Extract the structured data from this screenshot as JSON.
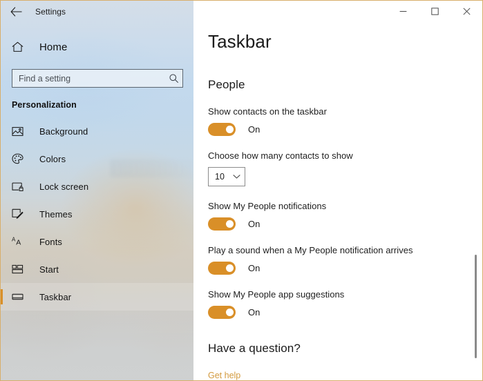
{
  "window": {
    "border_color": "#d8ae6a",
    "accent_color": "#d98f28",
    "link_color": "#d39a3e"
  },
  "titlebar": {
    "back_label": "back-arrow",
    "app_title": "Settings",
    "minimize_label": "Minimize",
    "maximize_label": "Maximize",
    "close_label": "Close"
  },
  "sidebar": {
    "home_label": "Home",
    "search": {
      "placeholder": "Find a setting",
      "value": ""
    },
    "group_label": "Personalization",
    "items": [
      {
        "label": "Background",
        "icon": "picture-icon",
        "selected": false
      },
      {
        "label": "Colors",
        "icon": "palette-icon",
        "selected": false
      },
      {
        "label": "Lock screen",
        "icon": "lock-screen-icon",
        "selected": false
      },
      {
        "label": "Themes",
        "icon": "themes-icon",
        "selected": false
      },
      {
        "label": "Fonts",
        "icon": "fonts-icon",
        "selected": false
      },
      {
        "label": "Start",
        "icon": "start-icon",
        "selected": false
      },
      {
        "label": "Taskbar",
        "icon": "taskbar-icon",
        "selected": true
      }
    ]
  },
  "main": {
    "page_title": "Taskbar",
    "sections": [
      {
        "title": "People",
        "settings": [
          {
            "label": "Show contacts on the taskbar",
            "control": "toggle",
            "state": "On"
          },
          {
            "label": "Choose how many contacts to show",
            "control": "dropdown",
            "value": "10"
          },
          {
            "label": "Show My People notifications",
            "control": "toggle",
            "state": "On"
          },
          {
            "label": "Play a sound when a My People notification arrives",
            "control": "toggle",
            "state": "On"
          },
          {
            "label": "Show My People app suggestions",
            "control": "toggle",
            "state": "On"
          }
        ]
      }
    ],
    "help": {
      "title": "Have a question?",
      "link_label": "Get help"
    }
  }
}
